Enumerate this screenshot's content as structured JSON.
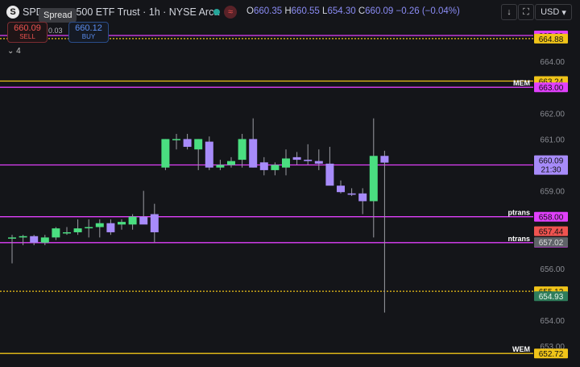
{
  "header": {
    "symbol_icon": "S",
    "title": "SPDR S&P 500 ETF Trust · 1h · NYSE Arca",
    "tooltip": "Spread",
    "status_icon": "≈",
    "ohlc": [
      {
        "key": "O",
        "value": "660.35"
      },
      {
        "key": "H",
        "value": "660.55"
      },
      {
        "key": "L",
        "value": "654.30"
      },
      {
        "key": "C",
        "value": "660.09"
      }
    ],
    "change": "−0.26 (−0.04%)",
    "currency": "USD",
    "currency_arrow": "▾",
    "download_icon": "↓",
    "fullscreen_icon": "⛶"
  },
  "trade": {
    "sell_price": "660.09",
    "sell_label": "SELL",
    "spread": "0.03",
    "buy_price": "660.12",
    "buy_label": "BUY"
  },
  "indicators_toggle": "⌄ 4",
  "colors": {
    "background": "#141519",
    "up": "#4ade80",
    "down": "#a78bfa",
    "magenta": "#e040fb",
    "gold": "#f0c419",
    "grid_text": "#8a8c93"
  },
  "chart_data": {
    "type": "candlestick",
    "y_axis_ticks": [
      "665.00",
      "664.00",
      "662.00",
      "661.00",
      "659.00",
      "656.00",
      "654.00",
      "653.00"
    ],
    "current_price": "660.09",
    "countdown": "21:30",
    "candles": [
      {
        "o": 657.2,
        "h": 657.3,
        "l": 656.2,
        "c": 657.2
      },
      {
        "o": 657.2,
        "h": 657.3,
        "l": 656.9,
        "c": 657.25
      },
      {
        "o": 657.25,
        "h": 657.3,
        "l": 656.9,
        "c": 657.0
      },
      {
        "o": 657.0,
        "h": 657.3,
        "l": 656.9,
        "c": 657.2
      },
      {
        "o": 657.2,
        "h": 657.6,
        "l": 657.1,
        "c": 657.55
      },
      {
        "o": 657.4,
        "h": 657.6,
        "l": 657.3,
        "c": 657.4
      },
      {
        "o": 657.4,
        "h": 657.9,
        "l": 657.3,
        "c": 657.55
      },
      {
        "o": 657.6,
        "h": 657.9,
        "l": 657.2,
        "c": 657.6
      },
      {
        "o": 657.6,
        "h": 657.9,
        "l": 657.2,
        "c": 657.75
      },
      {
        "o": 657.75,
        "h": 657.9,
        "l": 657.3,
        "c": 657.4
      },
      {
        "o": 657.7,
        "h": 657.9,
        "l": 657.5,
        "c": 657.8
      },
      {
        "o": 657.7,
        "h": 658.1,
        "l": 657.5,
        "c": 658.0
      },
      {
        "o": 658.0,
        "h": 659.0,
        "l": 657.8,
        "c": 657.7
      },
      {
        "o": 658.1,
        "h": 658.5,
        "l": 657.0,
        "c": 657.4
      },
      {
        "o": 659.9,
        "h": 661.0,
        "l": 659.8,
        "c": 661.0
      },
      {
        "o": 661.0,
        "h": 661.2,
        "l": 660.6,
        "c": 661.0
      },
      {
        "o": 661.0,
        "h": 661.2,
        "l": 660.6,
        "c": 660.7
      },
      {
        "o": 660.6,
        "h": 661.0,
        "l": 659.8,
        "c": 661.0
      },
      {
        "o": 660.9,
        "h": 661.1,
        "l": 659.8,
        "c": 659.9
      },
      {
        "o": 659.9,
        "h": 660.2,
        "l": 659.8,
        "c": 660.0
      },
      {
        "o": 660.0,
        "h": 660.3,
        "l": 659.9,
        "c": 660.15
      },
      {
        "o": 660.2,
        "h": 661.2,
        "l": 659.9,
        "c": 661.0
      },
      {
        "o": 661.0,
        "h": 661.8,
        "l": 659.9,
        "c": 659.9
      },
      {
        "o": 660.1,
        "h": 660.3,
        "l": 659.6,
        "c": 659.8
      },
      {
        "o": 659.8,
        "h": 660.1,
        "l": 659.6,
        "c": 660.0
      },
      {
        "o": 659.9,
        "h": 660.6,
        "l": 659.6,
        "c": 660.25
      },
      {
        "o": 660.3,
        "h": 660.5,
        "l": 660.0,
        "c": 660.2
      },
      {
        "o": 660.2,
        "h": 660.8,
        "l": 660.0,
        "c": 660.15
      },
      {
        "o": 660.15,
        "h": 660.6,
        "l": 659.8,
        "c": 660.05
      },
      {
        "o": 660.05,
        "h": 660.7,
        "l": 659.3,
        "c": 659.2
      },
      {
        "o": 659.2,
        "h": 659.4,
        "l": 658.9,
        "c": 658.95
      },
      {
        "o": 658.9,
        "h": 659.1,
        "l": 658.8,
        "c": 658.85
      },
      {
        "o": 658.9,
        "h": 659.1,
        "l": 658.1,
        "c": 658.6
      },
      {
        "o": 658.6,
        "h": 661.8,
        "l": 657.2,
        "c": 660.35
      },
      {
        "o": 660.35,
        "h": 660.55,
        "l": 654.3,
        "c": 660.09
      }
    ],
    "levels": [
      {
        "price": 665.0,
        "label": "",
        "tag": "665.00",
        "color": "#e040fb",
        "style": "solid",
        "tagText": "#111"
      },
      {
        "price": 664.88,
        "label": "",
        "tag": "664.88",
        "color": "#f0c419",
        "style": "dashed",
        "tagText": "#111"
      },
      {
        "price": 663.24,
        "label": "",
        "tag": "663.24",
        "color": "#f0c419",
        "style": "solid",
        "tagText": "#111"
      },
      {
        "price": 663.0,
        "label": "MEM",
        "tag": "663.00",
        "color": "#e040fb",
        "style": "solid",
        "tagText": "#111"
      },
      {
        "price": 660.0,
        "label": "",
        "tag": "660.00",
        "color": "#e040fb",
        "style": "solid",
        "tagText": "#111"
      },
      {
        "price": 658.0,
        "label": "ptrans",
        "tag": "658.00",
        "color": "#e040fb",
        "style": "solid",
        "tagText": "#111"
      },
      {
        "price": 657.0,
        "label": "ntrans",
        "tag": "657.00",
        "color": "#e040fb",
        "style": "solid",
        "tagText": "#111"
      },
      {
        "price": 655.12,
        "label": "",
        "tag": "655.12",
        "color": "#f0c419",
        "style": "dashed",
        "tagText": "#111"
      },
      {
        "price": 652.72,
        "label": "WEM",
        "tag": "652.72",
        "color": "#f0c419",
        "style": "solid",
        "tagText": "#111"
      }
    ],
    "extra_tags": [
      {
        "price": 657.44,
        "tag": "657.44",
        "bg": "#ef5350",
        "fg": "#111"
      },
      {
        "price": 657.02,
        "tag": "657.02",
        "bg": "#5f6368",
        "fg": "#ddd"
      },
      {
        "price": 654.93,
        "tag": "654.93",
        "bg": "#2e7d5b",
        "fg": "#e8f5e9"
      }
    ]
  }
}
